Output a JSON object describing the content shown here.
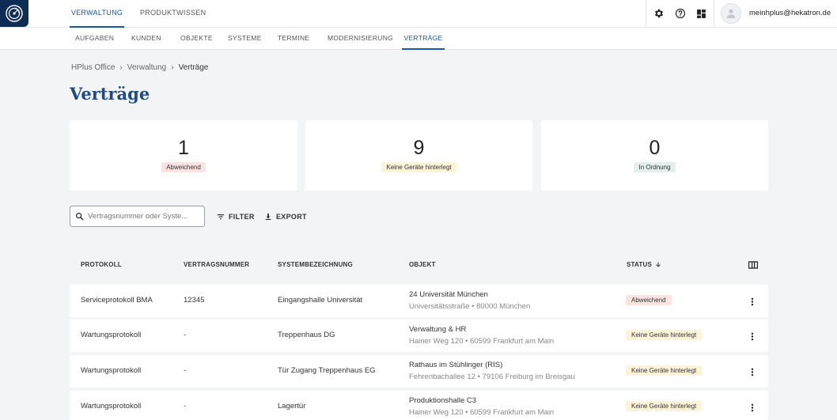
{
  "topnav": {
    "tabs": [
      {
        "label": "VERWALTUNG",
        "active": true
      },
      {
        "label": "PRODUKTWISSEN",
        "active": false
      }
    ],
    "icons": [
      "settings-icon",
      "help-icon",
      "apps-grid-icon"
    ],
    "user_email": "meinhplus@hekatron.de"
  },
  "subnav": {
    "tabs": [
      {
        "label": "AUFGABEN"
      },
      {
        "label": "KUNDEN"
      },
      {
        "label": "OBJEKTE"
      },
      {
        "label": "SYSTEME"
      },
      {
        "label": "TERMINE"
      },
      {
        "label": "MODERNISIERUNG"
      },
      {
        "label": "VERTRÄGE",
        "active": true
      }
    ]
  },
  "breadcrumb": [
    "HPlus Office",
    "Verwaltung",
    "Verträge"
  ],
  "page_title": "Verträge",
  "stats": [
    {
      "value": "1",
      "label": "Abweichend",
      "badge_color": "#fbe3e1"
    },
    {
      "value": "9",
      "label": "Keine Geräte hinterlegt",
      "badge_color": "#fdf3d8"
    },
    {
      "value": "0",
      "label": "In Ordnung",
      "badge_color": "#e2efec"
    }
  ],
  "toolbar": {
    "search_placeholder": "Vertragsnummer oder Syste...",
    "filter_label": "FILTER",
    "export_label": "EXPORT"
  },
  "table": {
    "headers": {
      "protokoll": "PROTOKOLL",
      "vertragsnummer": "VERTRAGSNUMMER",
      "systembezeichnung": "SYSTEMBEZEICHNUNG",
      "objekt": "OBJEKT",
      "status": "STATUS"
    },
    "status_sort": "descending",
    "rows": [
      {
        "protokoll": "Serviceprotokoll BMA",
        "vertragsnummer": "12345",
        "system": "Eingangshalle Universität",
        "objekt_name": "24 Universität München",
        "objekt_address": "Universitätsstraße • 80000 München",
        "status": "Abweichend",
        "status_color": "#fbe3e1"
      },
      {
        "protokoll": "Wartungsprotokoll",
        "vertragsnummer": "-",
        "system": "Treppenhaus DG",
        "objekt_name": "Verwaltung & HR",
        "objekt_address": "Hainer Weg 120 • 60599 Frankfurt am Main",
        "status": "Keine Geräte hinterlegt",
        "status_color": "#fdf3d8"
      },
      {
        "protokoll": "Wartungsprotokoll",
        "vertragsnummer": "-",
        "system": "Tür Zugang Treppenhaus EG",
        "objekt_name": "Rathaus im Stühlinger (RIS)",
        "objekt_address": "Fehrenbachallee 12 • 79106 Freiburg im Breisgau",
        "status": "Keine Geräte hinterlegt",
        "status_color": "#fdf3d8"
      },
      {
        "protokoll": "Wartungsprotokoll",
        "vertragsnummer": "-",
        "system": "Lagertür",
        "objekt_name": "Produktionshalle C3",
        "objekt_address": "Hainer Weg 120 • 60599 Frankfurt am Main",
        "status": "Keine Geräte hinterlegt",
        "status_color": "#fdf3d8"
      }
    ]
  }
}
